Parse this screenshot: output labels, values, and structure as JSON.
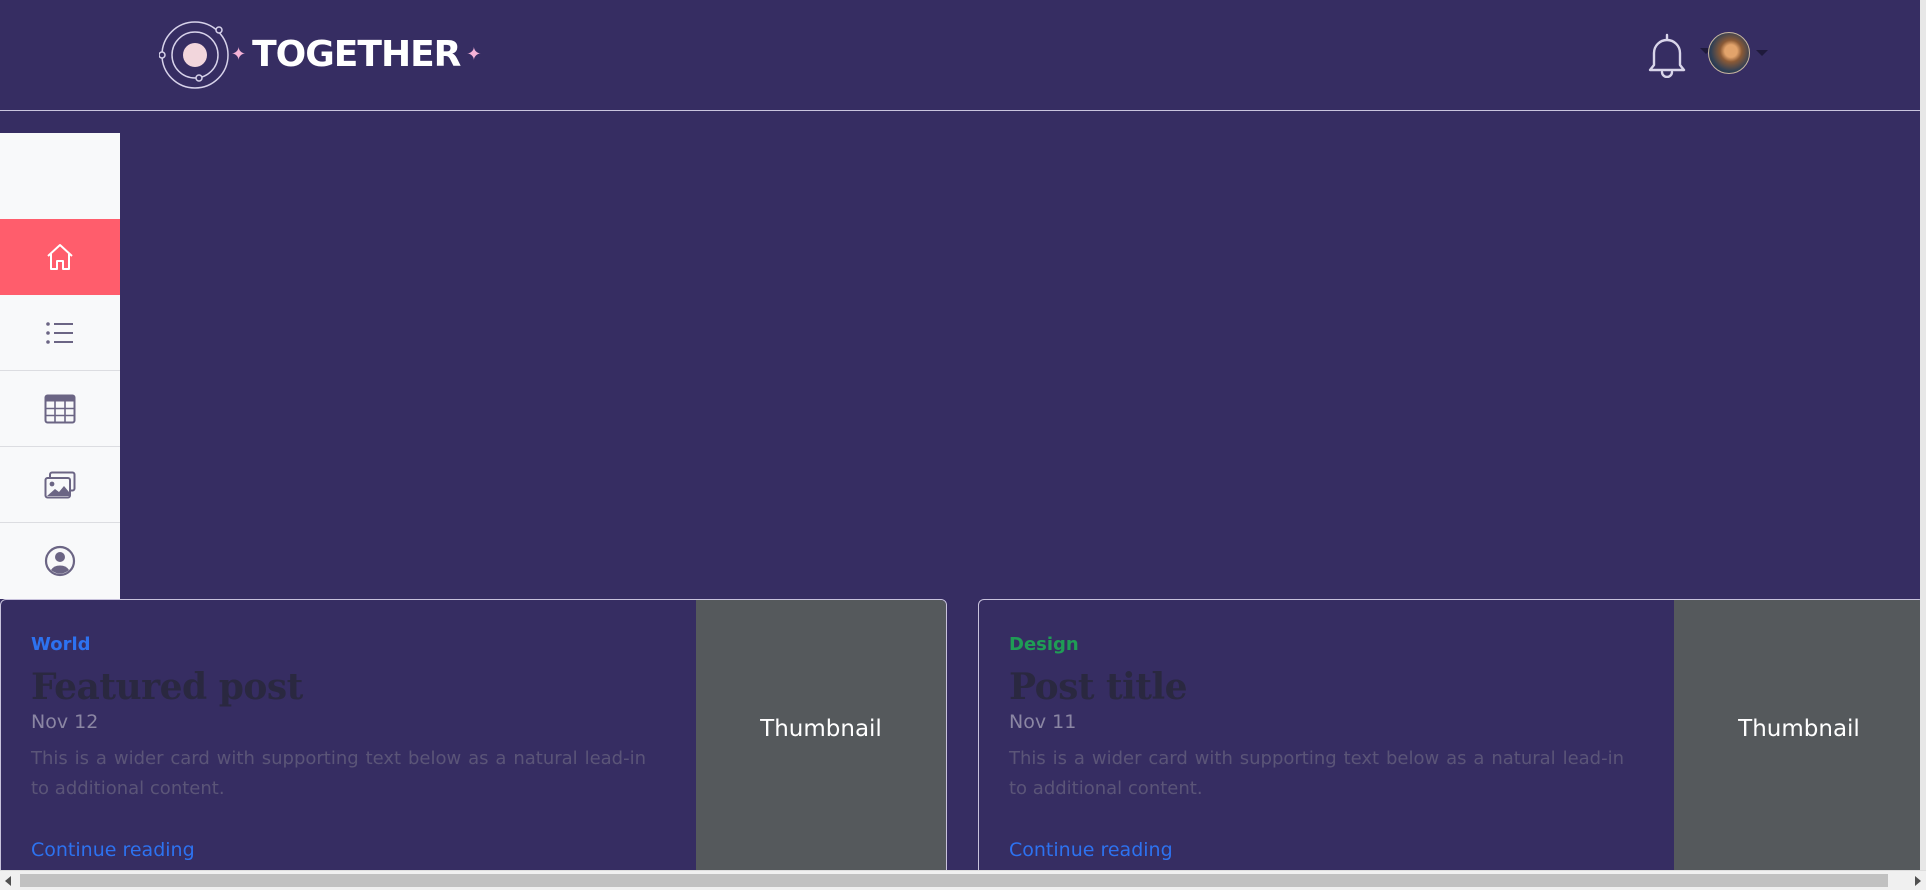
{
  "header": {
    "logo_text": "TOGETHER",
    "bell_icon": "bell-icon",
    "avatar_icon": "user-avatar"
  },
  "sidebar": {
    "items": [
      {
        "icon": "home-icon",
        "active": true
      },
      {
        "icon": "list-icon",
        "active": false
      },
      {
        "icon": "table-icon",
        "active": false
      },
      {
        "icon": "images-icon",
        "active": false
      },
      {
        "icon": "person-circle-icon",
        "active": false
      }
    ],
    "active_color": "#ff5d6c"
  },
  "cards": [
    {
      "category": "World",
      "category_color": "#2d72f0",
      "title": "Featured post",
      "date": "Nov 12",
      "text": "This is a wider card with supporting text below as a natural lead-in to additional content.",
      "link": "Continue reading",
      "thumbnail": "Thumbnail"
    },
    {
      "category": "Design",
      "category_color": "#1f9d55",
      "title": "Post title",
      "date": "Nov 11",
      "text": "This is a wider card with supporting text below as a natural lead-in to additional content.",
      "link": "Continue reading",
      "thumbnail": "Thumbnail"
    }
  ],
  "colors": {
    "background": "#362d62",
    "thumbnail_bg": "#55595c"
  }
}
